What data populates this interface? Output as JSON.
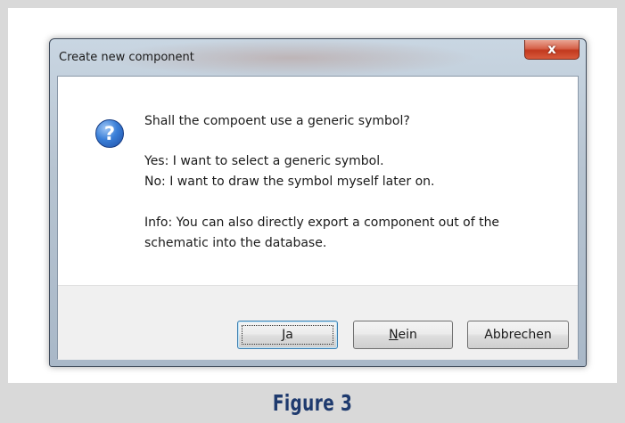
{
  "dialog": {
    "title": "Create new component",
    "close_glyph": "x"
  },
  "message": {
    "icon": "question-icon",
    "question": "Shall the compoent use a generic symbol?",
    "yes_line": "Yes: I want to select a generic symbol.",
    "no_line": "No: I want to draw the symbol myself later on.",
    "info_line1": "Info: You can also directly export a component out of the",
    "info_line2": "schematic into the database."
  },
  "buttons": {
    "yes": {
      "mnemonic": "J",
      "rest": "a"
    },
    "no": {
      "mnemonic": "N",
      "rest": "ein"
    },
    "cancel": {
      "label": "Abbrechen"
    }
  },
  "caption": {
    "text": "Figure 3",
    "color": "#1e3a6e"
  }
}
